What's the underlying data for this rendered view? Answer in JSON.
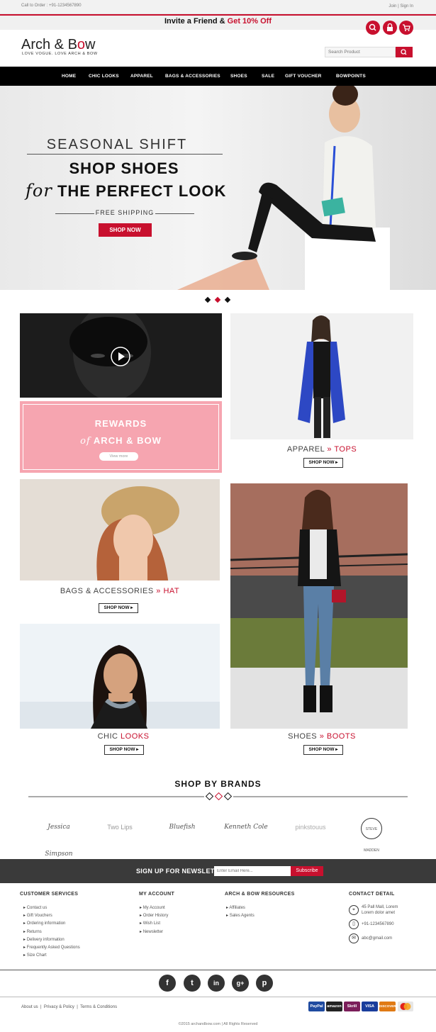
{
  "top_bar": {
    "call_text": "Call to Order : +91-1234567890",
    "join": "Join",
    "sign_in": "Sign In"
  },
  "invite": {
    "prefix": "Invite a Friend & ",
    "highlight": "Get 10% Off"
  },
  "header_icons": [
    "search-icon",
    "lock-icon",
    "cart-icon"
  ],
  "brand": {
    "name_a": "Arch & B",
    "name_b": "o",
    "name_c": "w",
    "tagline": "LOVE VOGUE. LOVE ARCH & BOW"
  },
  "search": {
    "placeholder": "Search Product"
  },
  "nav": [
    "HOME",
    "CHIC LOOKS",
    "APPAREL",
    "BAGS & ACCESSORIES",
    "SHOES",
    "SALE",
    "GIFT VOUCHER",
    "BOWPOINTS"
  ],
  "hero": {
    "line1": "SEASONAL SHIFT",
    "line2": "SHOP SHOES",
    "line3_italic": "for",
    "line3_rest": "THE PERFECT LOOK",
    "line4": "FREE SHIPPING",
    "cta": "SHOP NOW"
  },
  "rewards": {
    "line1": "REWARDS",
    "line2_italic": "of",
    "line2_rest": "ARCH & BOW",
    "button": "View more"
  },
  "tiles": {
    "apparel": {
      "cat": "APPAREL",
      "sub": "TOPS",
      "button": "SHOP NOW"
    },
    "bags": {
      "cat": "BAGS & ACCESSORIES",
      "sub": "HAT",
      "button": "SHOP NOW"
    },
    "chic": {
      "cat": "CHIC",
      "sub": "LOOKS",
      "button": "SHOP NOW"
    },
    "shoes": {
      "cat": "SHOES",
      "sub": "BOOTS",
      "button": "SHOP NOW"
    }
  },
  "brands": {
    "title": "SHOP BY BRANDS",
    "items": [
      "Jessica Simpson",
      "Two Lips",
      "Bluefish",
      "Kenneth Cole",
      "pinkstouus",
      "STEVE MADDEN"
    ]
  },
  "newsletter": {
    "label": "SIGN UP FOR NEWSLETTER",
    "placeholder": "Enter Email Here...",
    "button": "Subscribe"
  },
  "footer": {
    "customer_services": {
      "title": "CUSTOMER SERVICES",
      "items": [
        "Contact us",
        "Gift Vouchers",
        "Ordering information",
        "Returns",
        "Delivery information",
        "Frequently Asked Questions",
        "Size Chart"
      ]
    },
    "my_account": {
      "title": "MY ACCOUNT",
      "items": [
        "My Account",
        "Order History",
        "Wish List",
        "Newsletter"
      ]
    },
    "resources": {
      "title": "ARCH & BOW RESOURCES",
      "items": [
        "Affiliates",
        "Sales Agents"
      ]
    },
    "contact": {
      "title": "CONTACT DETAIL",
      "address": "45 Pall Mall, Lorem",
      "address2": "Lorem dolor amet",
      "phone": "+91-1234567890",
      "email": "abc@gmail.com"
    }
  },
  "social": [
    "f",
    "t",
    "in",
    "g+",
    "p"
  ],
  "bottom_links": [
    "About us",
    "Privacy & Policy",
    "Terms & Conditions"
  ],
  "payments": [
    {
      "name": "PayPal",
      "color": "#1f4aa0"
    },
    {
      "name": "amazon",
      "color": "#222222"
    },
    {
      "name": "Skrill",
      "color": "#7b1e5a"
    },
    {
      "name": "VISA",
      "color": "#1a3d9c"
    },
    {
      "name": "DISCOVER",
      "color": "#e07a14"
    },
    {
      "name": "MC",
      "color": "#e6e6e6"
    }
  ],
  "copyright": "©2015 archandbow.com | All Rights Reserved",
  "colors": {
    "accent": "#c8102e",
    "nav_bg": "#000000",
    "rewards_bg": "#f6a5b0"
  }
}
